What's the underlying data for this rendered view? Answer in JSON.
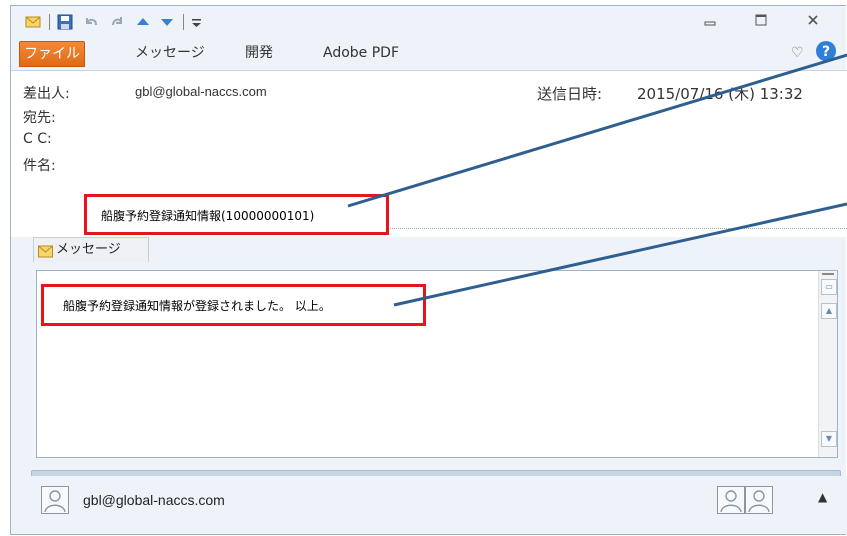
{
  "ribbon": {
    "tabs": [
      "ファイル",
      "メッセージ",
      "開発",
      "Adobe PDF"
    ]
  },
  "header": {
    "from_label": "差出人:",
    "from_value": "gbl@global-naccs.com",
    "to_label": "宛先:",
    "cc_label": "C C:",
    "subject_label": "件名:",
    "subject_value": "船腹予約登録通知情報(10000000101)",
    "sent_label": "送信日時:",
    "sent_value": "2015/07/16 (木) 13:32"
  },
  "message_tab": {
    "label": "メッセージ"
  },
  "body": {
    "text": "船腹予約登録通知情報が登録されました。 以上。"
  },
  "people_pane": {
    "sender": "gbl@global-naccs.com"
  },
  "colors": {
    "file_tab": "#e16a14",
    "highlight_box": "#e8141b",
    "arrow": "#2f5f8f"
  },
  "icons": [
    "envelope-icon",
    "save-icon",
    "undo-icon",
    "redo-icon",
    "up-arrow-icon",
    "down-arrow-icon",
    "customize-icon",
    "minimize-icon",
    "maximize-icon",
    "close-icon",
    "collapse-ribbon-icon",
    "help-icon",
    "person-icon",
    "expand-up-icon"
  ]
}
